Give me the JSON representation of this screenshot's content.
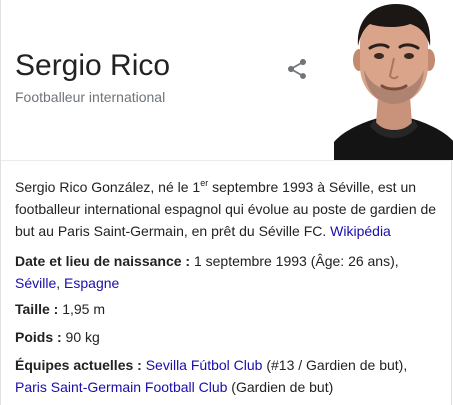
{
  "panel": {
    "name": "Sergio Rico",
    "subtitle": "Footballeur international"
  },
  "icons": {
    "share": "share-icon"
  },
  "colors": {
    "link": "#1a0dab",
    "text": "#222222",
    "muted": "#70757a",
    "divider": "#ebebeb"
  },
  "description": {
    "part1": "Sergio Rico González, né le 1",
    "sup": "er",
    "part2": " septembre 1993 à Séville, est un footballeur international espagnol qui évolue au poste de gardien de but au Paris Saint-Germain, en prêt du Séville FC. ",
    "source_link": "Wikipédia"
  },
  "facts": {
    "birth": {
      "label": "Date et lieu de naissance :",
      "value": " 1 septembre 1993 (Âge: 26 ans),",
      "place_city": "Séville",
      "separator": ", ",
      "place_country": "Espagne"
    },
    "height": {
      "label": "Taille :",
      "value": " 1,95 m"
    },
    "weight": {
      "label": "Poids :",
      "value": " 90 kg"
    },
    "teams": {
      "label": "Équipes actuelles :",
      "team1": "Sevilla Fútbol Club",
      "team1_detail": " (#13 / Gardien de but),",
      "team2": "Paris Saint-Germain Football Club",
      "team2_detail": " (Gardien de but)"
    }
  }
}
